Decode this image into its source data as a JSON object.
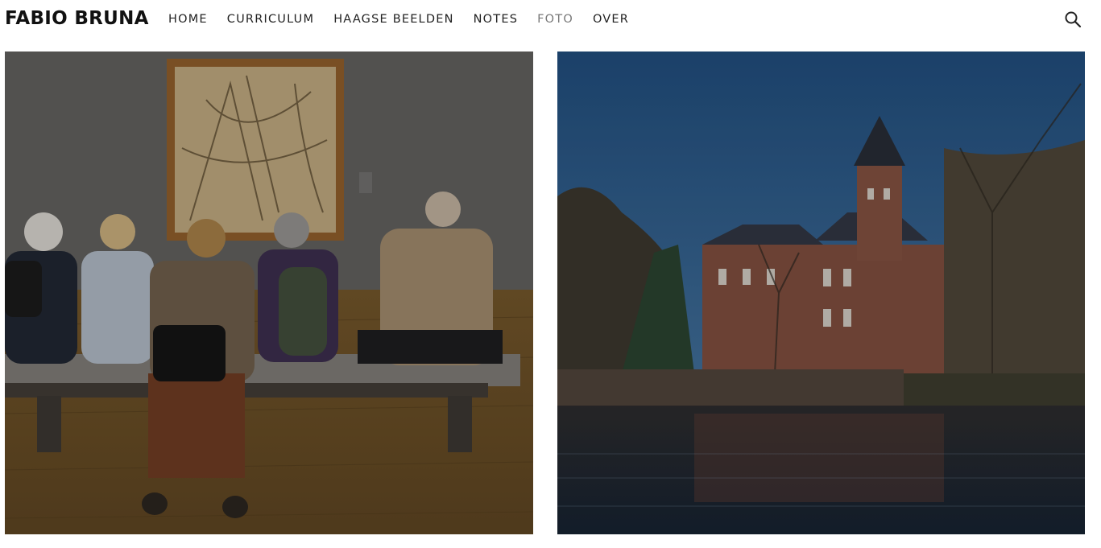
{
  "site": {
    "brand": "FABIO BRUNA"
  },
  "nav": {
    "items": [
      {
        "label": "HOME"
      },
      {
        "label": "CURRICULUM"
      },
      {
        "label": "HAAGSE BEELDEN"
      },
      {
        "label": "NOTES"
      },
      {
        "label": "FOTO",
        "active": true
      },
      {
        "label": "OVER"
      }
    ]
  },
  "icons": {
    "search": "search-icon"
  },
  "gallery": {
    "photos": [
      {
        "subject": "museum-visitors-on-bench"
      },
      {
        "subject": "castle-by-canal"
      }
    ]
  }
}
